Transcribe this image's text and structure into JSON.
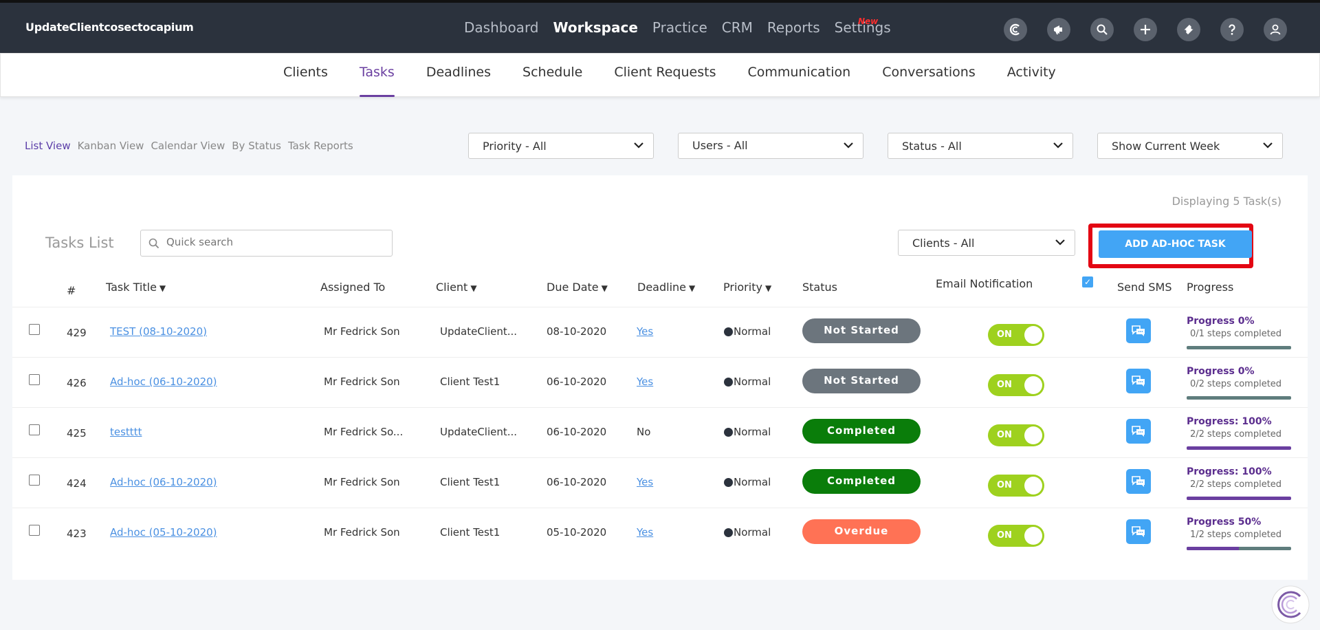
{
  "app": {
    "brand": "UpdateClientcosectocapium"
  },
  "topnav": {
    "items": [
      "Dashboard",
      "Workspace",
      "Practice",
      "CRM",
      "Reports",
      "Settings"
    ],
    "active": "Workspace",
    "new_badge": "New",
    "icons": [
      "capium-icon",
      "megaphone-icon",
      "search-icon",
      "plus-icon",
      "ticket-icon",
      "help-icon",
      "user-icon"
    ]
  },
  "subnav": {
    "items": [
      "Clients",
      "Tasks",
      "Deadlines",
      "Schedule",
      "Client Requests",
      "Communication",
      "Conversations",
      "Activity"
    ],
    "active": "Tasks"
  },
  "views": [
    "List View",
    "Kanban View",
    "Calendar View",
    "By Status",
    "Task Reports"
  ],
  "filters": {
    "priority": "Priority - All",
    "users": "Users - All",
    "status": "Status - All",
    "period": "Show Current Week"
  },
  "panel": {
    "displaying": "Displaying 5 Task(s)",
    "title": "Tasks List",
    "search_placeholder": "Quick search",
    "clients_filter": "Clients - All",
    "add_button": "ADD AD-HOC TASK"
  },
  "table": {
    "headers": {
      "num": "#",
      "title": "Task Title",
      "assigned": "Assigned To",
      "client": "Client",
      "due": "Due Date",
      "deadline": "Deadline",
      "priority": "Priority",
      "status": "Status",
      "email": "Email Notification",
      "sms": "Send SMS",
      "progress": "Progress"
    },
    "rows": [
      {
        "num": "429",
        "title": "TEST (08-10-2020)",
        "assigned": "Mr Fedrick Son",
        "client": "UpdateClient...",
        "due": "08-10-2020",
        "deadline": "Yes",
        "priority": "Normal",
        "status": "Not Started",
        "email": "ON",
        "progress_title": "Progress 0%",
        "progress_sub": "0/1 steps completed",
        "progress": 0
      },
      {
        "num": "426",
        "title": "Ad-hoc (06-10-2020)",
        "assigned": "Mr Fedrick Son",
        "client": "Client Test1",
        "due": "06-10-2020",
        "deadline": "Yes",
        "priority": "Normal",
        "status": "Not Started",
        "email": "ON",
        "progress_title": "Progress 0%",
        "progress_sub": "0/2 steps completed",
        "progress": 0
      },
      {
        "num": "425",
        "title": "testttt",
        "assigned": "Mr Fedrick So...",
        "client": "UpdateClient...",
        "due": "06-10-2020",
        "deadline": "No",
        "priority": "Normal",
        "status": "Completed",
        "email": "ON",
        "progress_title": "Progress: 100%",
        "progress_sub": "2/2 steps completed",
        "progress": 100
      },
      {
        "num": "424",
        "title": "Ad-hoc (06-10-2020)",
        "assigned": "Mr Fedrick Son",
        "client": "Client Test1",
        "due": "06-10-2020",
        "deadline": "Yes",
        "priority": "Normal",
        "status": "Completed",
        "email": "ON",
        "progress_title": "Progress: 100%",
        "progress_sub": "2/2 steps completed",
        "progress": 100
      },
      {
        "num": "423",
        "title": "Ad-hoc (05-10-2020)",
        "assigned": "Mr Fedrick Son",
        "client": "Client Test1",
        "due": "05-10-2020",
        "deadline": "Yes",
        "priority": "Normal",
        "status": "Overdue",
        "email": "ON",
        "progress_title": "Progress 50%",
        "progress_sub": "1/2 steps completed",
        "progress": 50
      }
    ]
  },
  "colors": {
    "accent_purple": "#6a3fa0",
    "button_blue": "#42a5f5",
    "status_not_started": "#6c757d",
    "status_completed": "#0a7d0a",
    "status_overdue": "#ff7255",
    "toggle_on": "#9ed11e"
  }
}
